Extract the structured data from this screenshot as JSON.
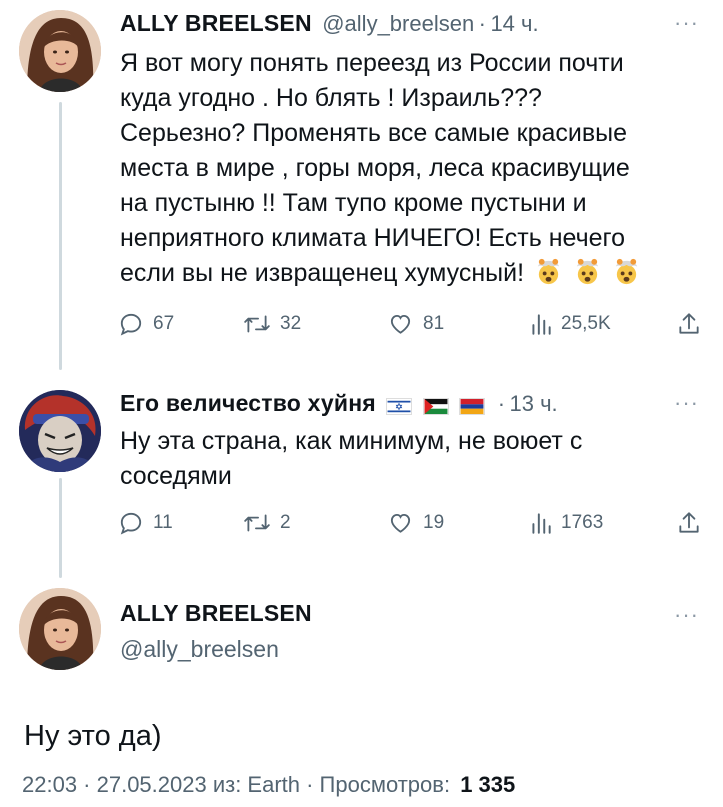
{
  "tweets": [
    {
      "author_name": "ALLY BREELSEN",
      "handle": "@ally_breelsen",
      "separator": "·",
      "time": "14 ч.",
      "lines": [
        "Я вот могу понять переезд из России почти",
        "куда угодно . Но блять ! Израиль???",
        "Серьезно? Променять все самые красивые",
        "места в мире , горы моря, леса красивущие",
        "на пустыню !! Там тупо кроме пустыни и",
        "неприятного климата НИЧЕГО! Есть нечего",
        "если вы не извращенец хумусный!"
      ],
      "emojis": [
        "exploding-head",
        "exploding-head",
        "exploding-head"
      ],
      "replies": "67",
      "retweets": "32",
      "likes": "81",
      "views": "25,5K"
    },
    {
      "author_name": "Его величество хуйня",
      "flags": [
        "israel-flag",
        "palestine-flag",
        "armenia-flag"
      ],
      "separator": "·",
      "time": "13 ч.",
      "lines": [
        "Ну эта страна, как минимум, не воюет с",
        "соседями"
      ],
      "replies": "11",
      "retweets": "2",
      "likes": "19",
      "views": "1763"
    }
  ],
  "main_tweet": {
    "author_name": "ALLY BREELSEN",
    "handle": "@ally_breelsen",
    "text": "Ну это да)",
    "timestamp": "22:03 · 27.05.2023 из: Earth · Просмотров:",
    "views": "1 335"
  },
  "more_label": "···",
  "colors": {
    "text": "#0f1419",
    "secondary": "#536471",
    "thread_line": "#cfd9de"
  }
}
